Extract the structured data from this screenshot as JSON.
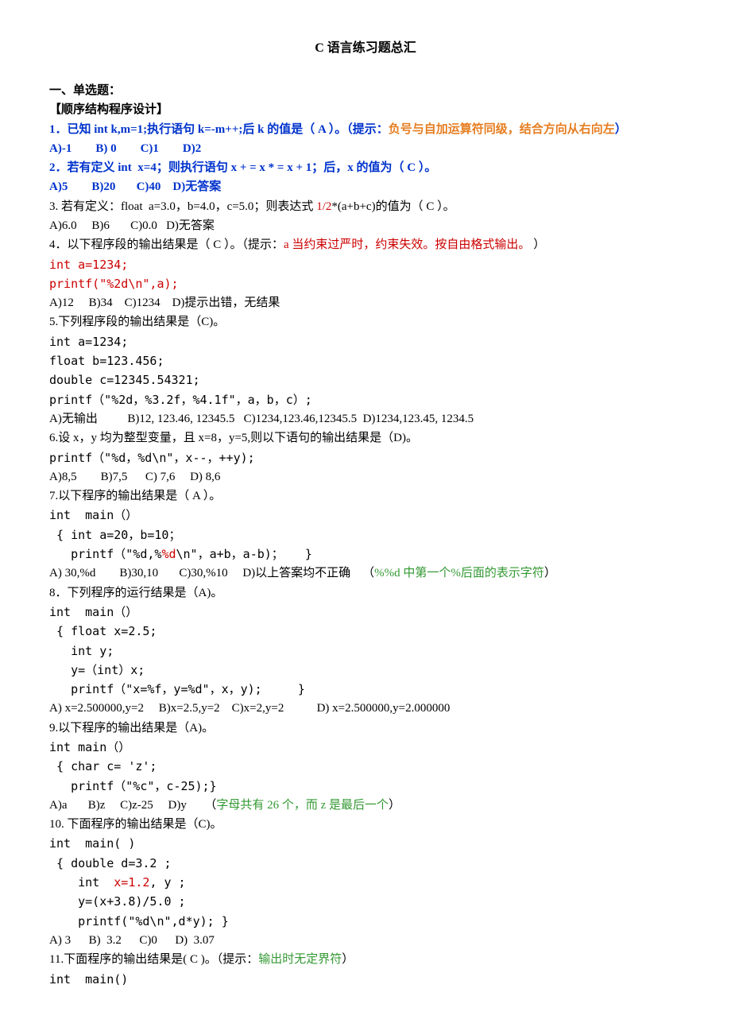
{
  "title": "C 语言练习题总汇",
  "section_heading": "一、单选题：",
  "subsection": "【顺序结构程序设计】",
  "q1": {
    "num": "1．",
    "text_a": "已知 int k,m=1;执行语句 k=-m++;后 k 的值是（ A ）。（提示：",
    "text_hint": "负号与自加运算符同级，结合方向从右向左",
    "text_b": "）",
    "opts": "A)-1        B) 0        C)1        D)2"
  },
  "q2": {
    "num": "2．",
    "text": "若有定义 int  x=4；则执行语句 x + = x * = x + 1；后，x 的值为（ C ）。",
    "opts": "A)5        B)20       C)40    D)无答案"
  },
  "q3": {
    "text_a": "3. 若有定义：float  a=3.0，b=4.0，c=5.0；则表达式 ",
    "frac": "1/2",
    "text_b": "*(a+b+c)的值为（ C ）。",
    "opts": "A)6.0     B)6       C)0.0   D)无答案"
  },
  "q4": {
    "text_a": "4．以下程序段的输出结果是（ C ）。（提示：",
    "hint": "a 当约束过严时，约束失效。按自由格式输出。",
    "text_b": " ）",
    "code1": "int a=1234;",
    "code2": "printf(\"%2d\\n\",a);",
    "opts": "A)12     B)34    C)1234    D)提示出错，无结果"
  },
  "q5": {
    "text": "5.下列程序段的输出结果是（C)。",
    "c1": "int a=1234;",
    "c2": "float b=123.456;",
    "c3": "double c=12345.54321;",
    "c4": "printf（\"%2d，%3.2f，%4.1f\"，a，b，c）;",
    "opts": "A)无输出          B)12, 123.46, 12345.5   C)1234,123.46,12345.5  D)1234,123.45, 1234.5"
  },
  "q6": {
    "text": "6.设 x，y 均为整型变量，且 x=8，y=5,则以下语句的输出结果是（D)。",
    "c1": "printf（\"%d，%d\\n\"，x--，++y);",
    "opts": "A)8,5        B)7,5      C) 7,6     D) 8,6"
  },
  "q7": {
    "text": "7.以下程序的输出结果是（ A ）。",
    "c1": "int  main（）",
    "c2": " { int a=20，b=10；",
    "c3a": "   printf（\"%d,%",
    "c3b": "%d",
    "c3c": "\\n\"，a+b，a-b)；   }",
    "opts_a": "A) 30,%d        B)30,10       C)30,%10     D)以上答案均不正确    （",
    "opts_hint": "%%d 中第一个%后面的表示字符",
    "opts_b": "）"
  },
  "q8": {
    "text": "8．下列程序的运行结果是（A)。",
    "c1": "int  main（）",
    "c2": " { float x=2.5;",
    "c3": "   int y;",
    "c4": "   y=（int）x;",
    "c5": "   printf（\"x=%f，y=%d\"，x，y);     }",
    "opts": "A) x=2.500000,y=2     B)x=2.5,y=2    C)x=2,y=2           D) x=2.500000,y=2.000000"
  },
  "q9": {
    "text": "9.以下程序的输出结果是（A)。",
    "c1": "int main（）",
    "c2": " { char c= 'z';",
    "c3": "   printf（\"%c\"，c-25);}",
    "opts_a": "A)a       B)z     C)z-25     D)y      （",
    "opts_hint": "字母共有 26 个，而 z 是最后一个",
    "opts_b": "）"
  },
  "q10": {
    "text": "10. 下面程序的输出结果是（C)。",
    "c1": "int  main( )",
    "c2": " { double d=3.2 ;",
    "c3a": "    int  ",
    "c3b": "x=1.2",
    "c3c": ", y ;",
    "c4": "    y=(x+3.8)/5.0 ;",
    "c5": "    printf(\"%d\\n\",d*y); }",
    "opts": "A) 3      B)  3.2      C)0      D)  3.07"
  },
  "q11": {
    "text_a": "11.下面程序的输出结果是( C )。（提示：",
    "hint": "输出时无定界符",
    "text_b": "）",
    "c1": "int  main()"
  }
}
